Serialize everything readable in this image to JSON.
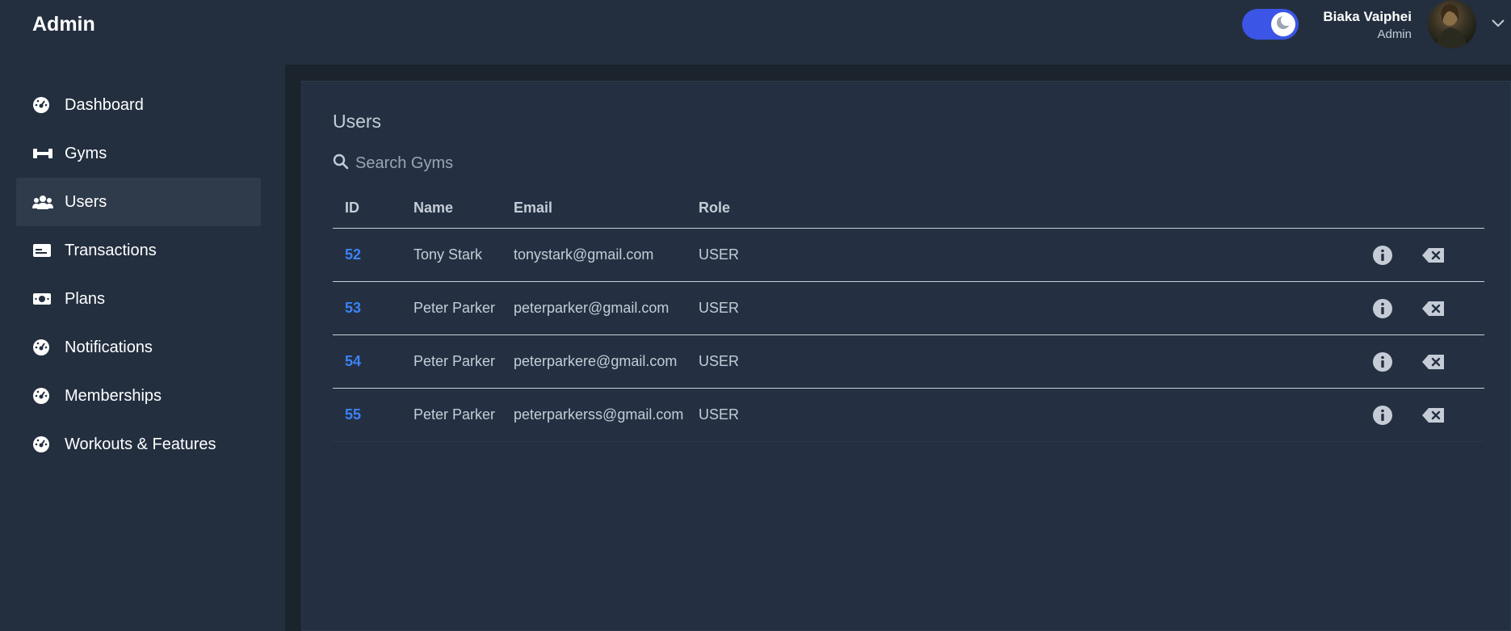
{
  "header": {
    "brand": "Admin",
    "theme_toggle": {
      "state": "dark",
      "icon": "moon-icon"
    },
    "user": {
      "name": "Biaka Vaiphei",
      "role": "Admin",
      "menu_icon": "chevron-down-icon"
    }
  },
  "sidebar": {
    "items": [
      {
        "label": "Dashboard",
        "icon": "dashboard-gauge-icon",
        "active": false
      },
      {
        "label": "Gyms",
        "icon": "dumbbell-icon",
        "active": false
      },
      {
        "label": "Users",
        "icon": "users-icon",
        "active": true
      },
      {
        "label": "Transactions",
        "icon": "card-icon",
        "active": false
      },
      {
        "label": "Plans",
        "icon": "money-icon",
        "active": false
      },
      {
        "label": "Notifications",
        "icon": "dashboard-gauge-icon",
        "active": false
      },
      {
        "label": "Memberships",
        "icon": "dashboard-gauge-icon",
        "active": false
      },
      {
        "label": "Workouts & Features",
        "icon": "dashboard-gauge-icon",
        "active": false
      }
    ]
  },
  "main": {
    "title": "Users",
    "search": {
      "placeholder": "Search Gyms",
      "value": ""
    },
    "table": {
      "columns": [
        "ID",
        "Name",
        "Email",
        "Role"
      ],
      "rows": [
        {
          "id": "52",
          "name": "Tony Stark",
          "email": "tonystark@gmail.com",
          "role": "USER"
        },
        {
          "id": "53",
          "name": "Peter Parker",
          "email": "peterparker@gmail.com",
          "role": "USER"
        },
        {
          "id": "54",
          "name": "Peter Parker",
          "email": "peterparkere@gmail.com",
          "role": "USER"
        },
        {
          "id": "55",
          "name": "Peter Parker",
          "email": "peterparkerss@gmail.com",
          "role": "USER"
        }
      ],
      "row_actions": [
        "info-icon",
        "delete-icon"
      ]
    }
  },
  "colors": {
    "background": "#1b232d",
    "panel": "#232f3f",
    "content": "#243042",
    "accent": "#3b55e6",
    "link": "#3b82f6",
    "active_item": "#2f3b4b"
  }
}
